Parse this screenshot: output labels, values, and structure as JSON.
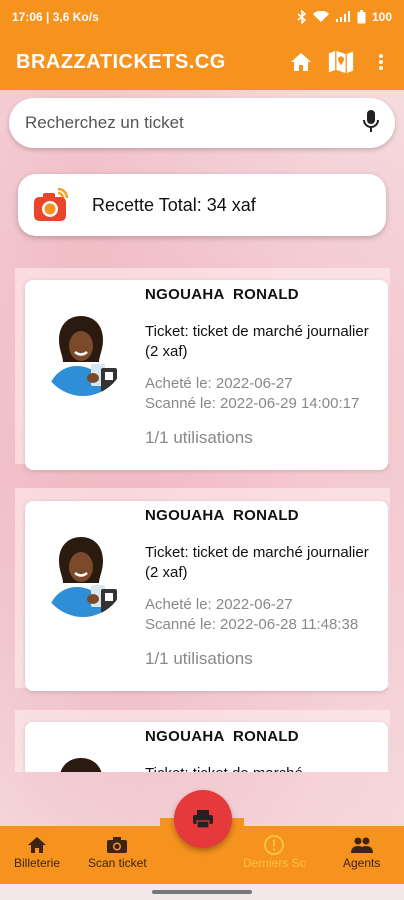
{
  "status_bar": {
    "left": "17:06 | 3,6 Ko/s",
    "battery": "100"
  },
  "app_bar": {
    "title": "BRAZZATICKETS.CG"
  },
  "search": {
    "placeholder": "Recherchez un ticket"
  },
  "summary": {
    "label": "Recette Total: 34 xaf"
  },
  "tickets": [
    {
      "name": "NGOUAHA  RONALD",
      "ticket": "Ticket: ticket de marché journalier (2 xaf)",
      "bought": "Acheté le: 2022-06-27",
      "scanned": "Scanné le: 2022-06-29 14:00:17",
      "uses": "1/1 utilisations"
    },
    {
      "name": "NGOUAHA  RONALD",
      "ticket": "Ticket: ticket de marché journalier (2 xaf)",
      "bought": "Acheté le: 2022-06-27",
      "scanned": "Scanné le: 2022-06-28 11:48:38",
      "uses": "1/1 utilisations"
    },
    {
      "name": "NGOUAHA  RONALD",
      "ticket": "Ticket: ticket de marché",
      "bought": "",
      "scanned": "",
      "uses": ""
    }
  ],
  "bottom_nav": {
    "items": [
      {
        "label": "Billeterie",
        "icon": "home-icon"
      },
      {
        "label": "Scan ticket",
        "icon": "camera-icon"
      },
      {
        "label": "Derniers Sc",
        "icon": "info-icon"
      },
      {
        "label": "Agents",
        "icon": "people-icon"
      }
    ],
    "fab_icon": "printer-icon"
  },
  "colors": {
    "primary": "#f6921e",
    "fab": "#e5393b",
    "active_nav": "#f9c43c"
  }
}
